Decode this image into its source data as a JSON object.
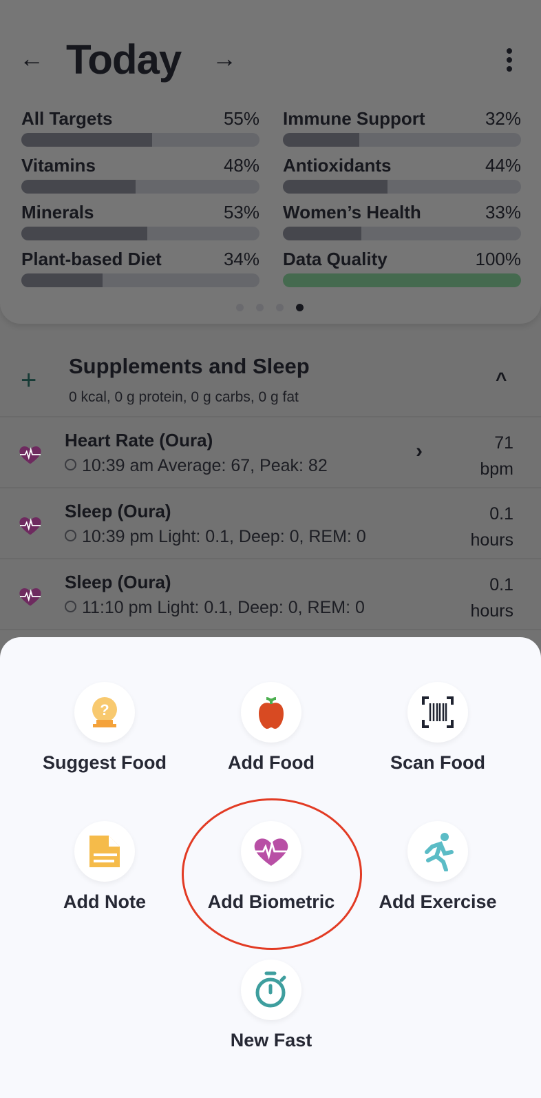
{
  "header": {
    "title": "Today",
    "prev_icon": "arrow-left-icon",
    "next_icon": "arrow-right-icon",
    "menu_icon": "more-vertical-icon"
  },
  "targets": [
    {
      "label": "All Targets",
      "percent": "55%",
      "value": 55
    },
    {
      "label": "Immune Support",
      "percent": "32%",
      "value": 32
    },
    {
      "label": "Vitamins",
      "percent": "48%",
      "value": 48
    },
    {
      "label": "Antioxidants",
      "percent": "44%",
      "value": 44
    },
    {
      "label": "Minerals",
      "percent": "53%",
      "value": 53
    },
    {
      "label": "Women’s Health",
      "percent": "33%",
      "value": 33
    },
    {
      "label": "Plant-based Diet",
      "percent": "34%",
      "value": 34
    },
    {
      "label": "Data Quality",
      "percent": "100%",
      "value": 100,
      "color": "#456a4f"
    }
  ],
  "pager": {
    "pages": 4,
    "active": 4
  },
  "section": {
    "title": "Supplements and Sleep",
    "summary": "0 kcal, 0 g protein, 0 g carbs, 0 g fat"
  },
  "entries": [
    {
      "name": "Heart Rate (Oura)",
      "detail": "10:39 am Average: 67, Peak: 82",
      "value": "71",
      "unit": "bpm",
      "has_chevron": true
    },
    {
      "name": "Sleep (Oura)",
      "detail": "10:39 pm Light: 0.1, Deep: 0, REM: 0",
      "value": "0.1",
      "unit": "hours"
    },
    {
      "name": "Sleep (Oura)",
      "detail": "11:10 pm Light: 0.1, Deep: 0, REM: 0",
      "value": "0.1",
      "unit": "hours"
    }
  ],
  "actions": [
    {
      "label": "Suggest Food",
      "icon": "crystal-ball-question-icon"
    },
    {
      "label": "Add Food",
      "icon": "apple-icon"
    },
    {
      "label": "Scan Food",
      "icon": "barcode-icon"
    },
    {
      "label": "Add Note",
      "icon": "note-icon"
    },
    {
      "label": "Add Biometric",
      "icon": "heart-pulse-icon",
      "highlighted": true
    },
    {
      "label": "Add Exercise",
      "icon": "running-icon"
    },
    {
      "label": "New Fast",
      "icon": "stopwatch-icon"
    }
  ],
  "colors": {
    "highlight_ring": "#e23b24",
    "biometric": "#b84fa5",
    "heart_list": "#6e2a5f",
    "exercise": "#5bbcc6",
    "fast": "#3e9e9e",
    "note": "#f5bb4a",
    "apple": "#d84a22"
  }
}
